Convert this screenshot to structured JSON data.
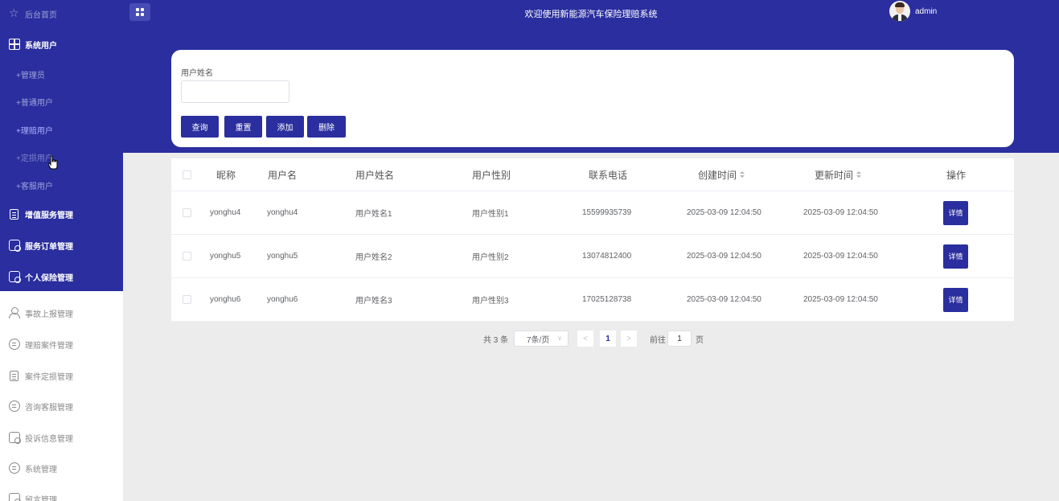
{
  "header": {
    "title": "欢迎使用新能源汽车保险理赔系统",
    "username": "admin"
  },
  "sidebar": {
    "items": [
      {
        "label": "后台首页",
        "icon": "star-icon"
      },
      {
        "label": "系统用户",
        "icon": "grid-icon"
      },
      {
        "label": "+管理员"
      },
      {
        "label": "+普通用户"
      },
      {
        "label": "+理赔用户"
      },
      {
        "label": "+定损用户"
      },
      {
        "label": "+客服用户"
      },
      {
        "label": "增值服务管理",
        "icon": "document-icon"
      },
      {
        "label": "服务订单管理",
        "icon": "clipboard-icon"
      },
      {
        "label": "个人保险管理",
        "icon": "clipboard-icon"
      },
      {
        "label": "事故上报管理",
        "icon": "user-icon"
      },
      {
        "label": "理赔案件管理",
        "icon": "chat-icon"
      },
      {
        "label": "案件定损管理",
        "icon": "document-icon"
      },
      {
        "label": "咨询客服管理",
        "icon": "chat-icon"
      },
      {
        "label": "投诉信息管理",
        "icon": "clipboard-icon"
      },
      {
        "label": "系统管理",
        "icon": "chat-icon"
      },
      {
        "label": "留言管理",
        "icon": "clipboard-icon"
      }
    ]
  },
  "search": {
    "label": "用户姓名",
    "value": "",
    "buttons": {
      "query": "查询",
      "reset": "重置",
      "add": "添加",
      "delete": "删除"
    }
  },
  "table": {
    "columns": [
      "昵称",
      "用户名",
      "用户姓名",
      "用户性别",
      "联系电话",
      "创建时间",
      "更新时间",
      "操作"
    ],
    "rows": [
      [
        "yonghu4",
        "yonghu4",
        "用户姓名1",
        "用户性别1",
        "15599935739",
        "2025-03-09 12:04:50",
        "2025-03-09 12:04:50",
        "详情"
      ],
      [
        "yonghu5",
        "yonghu5",
        "用户姓名2",
        "用户性别2",
        "13074812400",
        "2025-03-09 12:04:50",
        "2025-03-09 12:04:50",
        "详情"
      ],
      [
        "yonghu6",
        "yonghu6",
        "用户姓名3",
        "用户性别3",
        "17025128738",
        "2025-03-09 12:04:50",
        "2025-03-09 12:04:50",
        "详情"
      ]
    ]
  },
  "pagination": {
    "total": "共 3 条",
    "page_size": "7条/页",
    "prev": "<",
    "current": "1",
    "next": ">",
    "goto_prefix": "前往",
    "goto_value": "1",
    "goto_suffix": "页"
  },
  "colors": {
    "primary": "#2a2e9e",
    "sidebar_text_dim": "#9ea3d8",
    "background": "#ececec"
  }
}
